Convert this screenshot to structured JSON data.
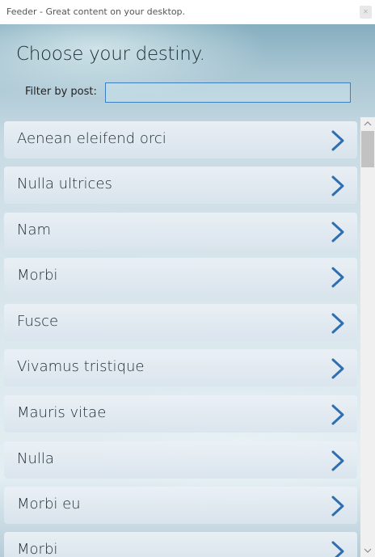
{
  "window": {
    "title": "Feeder - Great content on your desktop.",
    "close_glyph": "✕"
  },
  "main": {
    "heading": "Choose your destiny.",
    "filter_label": "Filter by post:",
    "filter_value": "",
    "filter_placeholder": ""
  },
  "items": [
    {
      "label": "Aenean eleifend orci",
      "icon": "chevron-right-icon"
    },
    {
      "label": "Nulla ultrices",
      "icon": "chevron-right-icon"
    },
    {
      "label": "Nam",
      "icon": "chevron-right-icon"
    },
    {
      "label": "Morbi",
      "icon": "chevron-right-icon"
    },
    {
      "label": "Fusce",
      "icon": "chevron-right-icon"
    },
    {
      "label": "Vivamus tristique",
      "icon": "chevron-right-icon"
    },
    {
      "label": "Mauris vitae",
      "icon": "chevron-right-icon"
    },
    {
      "label": "Nulla",
      "icon": "chevron-right-icon"
    },
    {
      "label": "Morbi eu",
      "icon": "chevron-right-icon"
    },
    {
      "label": "Morbi",
      "icon": "chevron-right-icon"
    }
  ],
  "colors": {
    "chevron": "#2f6fb1",
    "input_border": "#3d7fc1",
    "heading_text": "#1c2a32"
  },
  "scrollbar": {
    "scroll_position": 0
  }
}
